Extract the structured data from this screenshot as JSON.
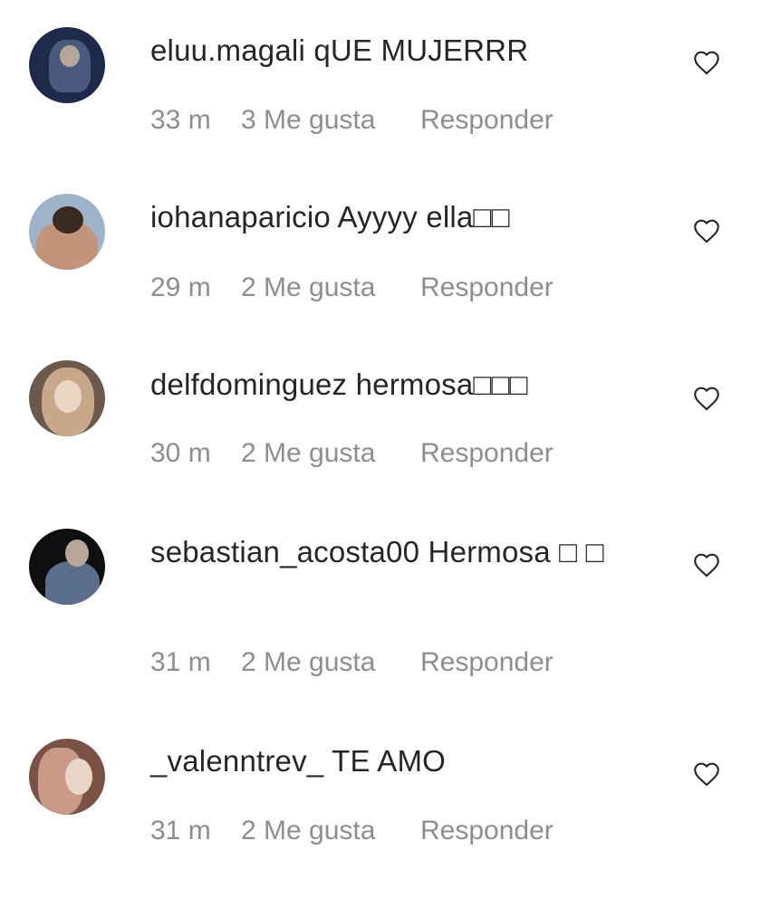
{
  "comments": [
    {
      "username": "eluu.magali",
      "text": "qUE MUJERRR",
      "time": "33 m",
      "likes": "3 Me gusta",
      "reply": "Responder",
      "avatar_colors": [
        "#1d2a4a",
        "#4a5a7e",
        "#b7a79a"
      ]
    },
    {
      "username": "iohanaparicio",
      "text": "Ayyyy ella□□",
      "time": "29 m",
      "likes": "2 Me gusta",
      "reply": "Responder",
      "avatar_colors": [
        "#9fb3c8",
        "#c2957a",
        "#3a2a22"
      ]
    },
    {
      "username": "delfdominguez",
      "text": "hermosa□□□",
      "time": "30 m",
      "likes": "2 Me gusta",
      "reply": "Responder",
      "avatar_colors": [
        "#6b5a4c",
        "#c9a78a",
        "#e8d7c4"
      ]
    },
    {
      "username": "sebastian_acosta00",
      "text": "Hermosa □ □",
      "time": "31 m",
      "likes": "2 Me gusta",
      "reply": "Responder",
      "avatar_colors": [
        "#0f0f12",
        "#5b6e8c",
        "#b9a89a"
      ]
    },
    {
      "username": "_valenntrev_",
      "text": "TE AMO",
      "time": "31 m",
      "likes": "2 Me gusta",
      "reply": "Responder",
      "avatar_colors": [
        "#7a5346",
        "#c99a86",
        "#e9d4c8"
      ]
    }
  ]
}
